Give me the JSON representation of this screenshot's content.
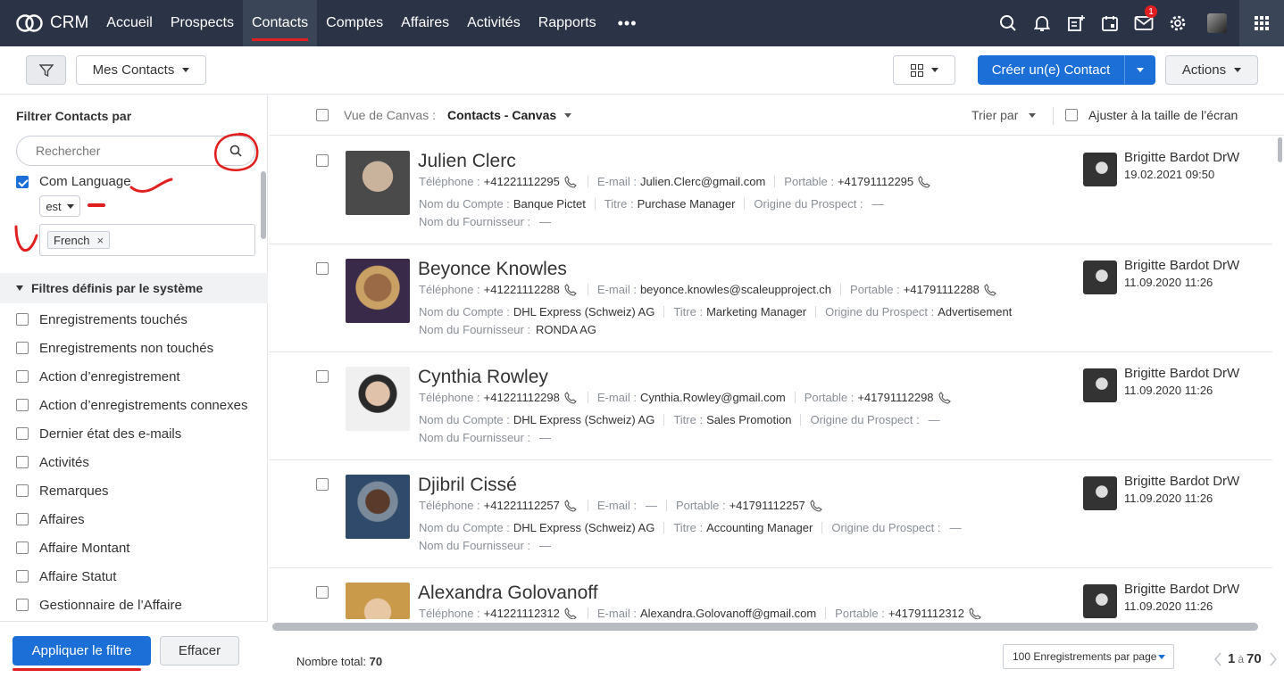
{
  "app": {
    "name": "CRM"
  },
  "nav": {
    "items": [
      "Accueil",
      "Prospects",
      "Contacts",
      "Comptes",
      "Affaires",
      "Activités",
      "Rapports"
    ],
    "more": "•••",
    "active": "Contacts"
  },
  "top_icons": {
    "notification_count": "1",
    "icons": [
      "search-icon",
      "bell-icon",
      "add-note-icon",
      "calendar-icon",
      "mail-icon",
      "gear-icon",
      "apps-grid-icon"
    ]
  },
  "toolbar": {
    "view_select": "Mes Contacts",
    "create_button": "Créer un(e) Contact",
    "actions_button": "Actions"
  },
  "sidebar": {
    "title": "Filtrer Contacts par",
    "search_placeholder": "Rechercher",
    "filter_field": "Com Language",
    "filter_operator": "est",
    "filter_value_tag": "French",
    "tag_remove": "×",
    "system_section": "Filtres définis par le système",
    "system_filters": [
      "Enregistrements touchés",
      "Enregistrements non touchés",
      "Action d’enregistrement",
      "Action d’enregistrements connexes",
      "Dernier état des e-mails",
      "Activités",
      "Remarques",
      "Affaires",
      "Affaire Montant",
      "Affaire Statut",
      "Gestionnaire de l’Affaire"
    ],
    "apply_button": "Appliquer le filtre",
    "clear_button": "Effacer"
  },
  "list_header": {
    "view_label": "Vue de Canvas :",
    "view_value": "Contacts - Canvas",
    "sort_label": "Trier par",
    "fit_label": "Ajuster à la taille de l’écran"
  },
  "labels": {
    "phone": "Téléphone :",
    "email": "E-mail :",
    "mobile": "Portable :",
    "account": "Nom du Compte :",
    "title": "Titre :",
    "source": "Origine du Prospect :",
    "supplier": "Nom du Fournisseur :"
  },
  "contacts": [
    {
      "name": "Julien Clerc",
      "phone": "+41221112295",
      "email": "Julien.Clerc@gmail.com",
      "mobile": "+41791112295",
      "account": "Banque Pictet",
      "title": "Purchase Manager",
      "source": "—",
      "supplier": "—",
      "owner": "Brigitte Bardot DrW",
      "date": "19.02.2021 09:50"
    },
    {
      "name": "Beyonce Knowles",
      "phone": "+41221112288",
      "email": "beyonce.knowles@scaleupproject.ch",
      "mobile": "+41791112288",
      "account": "DHL Express (Schweiz) AG",
      "title": "Marketing Manager",
      "source": "Advertisement",
      "supplier": "RONDA AG",
      "owner": "Brigitte Bardot DrW",
      "date": "11.09.2020 11:26"
    },
    {
      "name": "Cynthia Rowley",
      "phone": "+41221112298",
      "email": "Cynthia.Rowley@gmail.com",
      "mobile": "+41791112298",
      "account": "DHL Express (Schweiz) AG",
      "title": "Sales Promotion",
      "source": "—",
      "supplier": "—",
      "owner": "Brigitte Bardot DrW",
      "date": "11.09.2020 11:26"
    },
    {
      "name": "Djibril Cissé",
      "phone": "+41221112257",
      "email": "—",
      "mobile": "+41791112257",
      "account": "DHL Express (Schweiz) AG",
      "title": "Accounting Manager",
      "source": "—",
      "supplier": "—",
      "owner": "Brigitte Bardot DrW",
      "date": "11.09.2020 11:26"
    },
    {
      "name": "Alexandra Golovanoff",
      "phone": "+41221112312",
      "email": "Alexandra.Golovanoff@gmail.com",
      "mobile": "+41791112312",
      "account": "",
      "title": "",
      "source": "",
      "supplier": "",
      "owner": "Brigitte Bardot DrW",
      "date": "11.09.2020 11:26"
    }
  ],
  "footer": {
    "total_label": "Nombre total:",
    "total_value": "70",
    "per_page": "100 Enregistrements par page",
    "range_from": "1",
    "range_sep": "à",
    "range_to": "70"
  },
  "colors": {
    "topbar": "#2b3446",
    "primary": "#1c6fd6",
    "annotation": "#e02020"
  }
}
